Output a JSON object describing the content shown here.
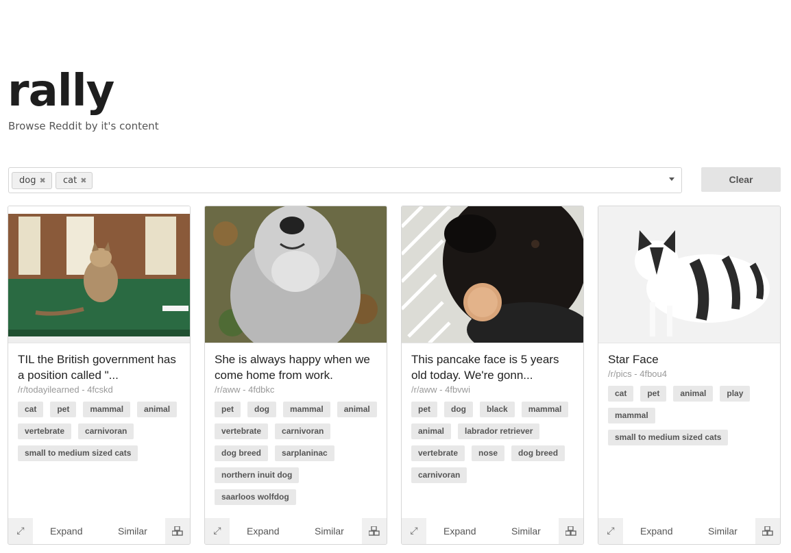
{
  "app": {
    "logo": "rally",
    "tagline": "Browse Reddit by it's content"
  },
  "search": {
    "chips": [
      {
        "label": "dog"
      },
      {
        "label": "cat"
      }
    ],
    "clear_label": "Clear"
  },
  "cards": [
    {
      "title": "TIL the British government has a position called \"...",
      "subtitle": "/r/todayilearned - 4fcskd",
      "tags": [
        "cat",
        "pet",
        "mammal",
        "animal",
        "vertebrate",
        "carnivoran",
        "small to medium sized cats"
      ],
      "expand_label": "Expand",
      "similar_label": "Similar"
    },
    {
      "title": "She is always happy when we come home from work.",
      "subtitle": "/r/aww - 4fdbkc",
      "tags": [
        "pet",
        "dog",
        "mammal",
        "animal",
        "vertebrate",
        "carnivoran",
        "dog breed",
        "sarplaninac",
        "northern inuit dog",
        "saarloos wolfdog"
      ],
      "expand_label": "Expand",
      "similar_label": "Similar"
    },
    {
      "title": "This pancake face is 5 years old today. We're gonn...",
      "subtitle": "/r/aww - 4fbvwi",
      "tags": [
        "pet",
        "dog",
        "black",
        "mammal",
        "animal",
        "labrador retriever",
        "vertebrate",
        "nose",
        "dog breed",
        "carnivoran"
      ],
      "expand_label": "Expand",
      "similar_label": "Similar"
    },
    {
      "title": "Star Face",
      "subtitle": "/r/pics - 4fbou4",
      "tags": [
        "cat",
        "pet",
        "animal",
        "play",
        "mammal",
        "small to medium sized cats"
      ],
      "expand_label": "Expand",
      "similar_label": "Similar"
    }
  ]
}
